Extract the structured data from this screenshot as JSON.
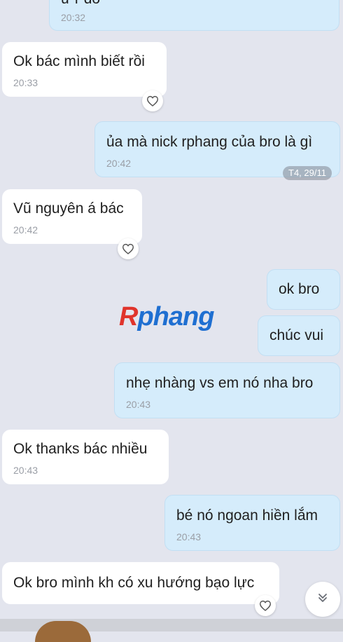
{
  "messages": [
    {
      "text": "ừ r đó",
      "time": "20:32"
    },
    {
      "text": "Ok bác mình biết rồi",
      "time": "20:33"
    },
    {
      "text": "ủa mà nick rphang của bro là gì",
      "time": "20:42"
    },
    {
      "text": "Vũ nguyên á bác",
      "time": "20:42"
    },
    {
      "text": "ok bro"
    },
    {
      "text": "chúc vui"
    },
    {
      "text": "nhẹ nhàng vs em nó nha bro",
      "time": "20:43"
    },
    {
      "text": "Ok thanks bác nhiều",
      "time": "20:43"
    },
    {
      "text": "bé nó ngoan hiền lắm",
      "time": "20:43"
    },
    {
      "text": "Ok bro mình kh có xu hướng bạo lực"
    }
  ],
  "date_pill": "T4, 29/11",
  "watermark": {
    "part1": "R",
    "part2": "phang"
  },
  "icons": {
    "reaction": "heart-outline-icon",
    "scroll": "double-chevron-down-icon"
  },
  "colors": {
    "background": "#e3e5ee",
    "incoming_bubble": "#ffffff",
    "outgoing_bubble": "#d5ecfb",
    "timestamp": "#9a9ea6",
    "watermark_red": "#e0342c",
    "watermark_blue": "#1f6fd1"
  }
}
